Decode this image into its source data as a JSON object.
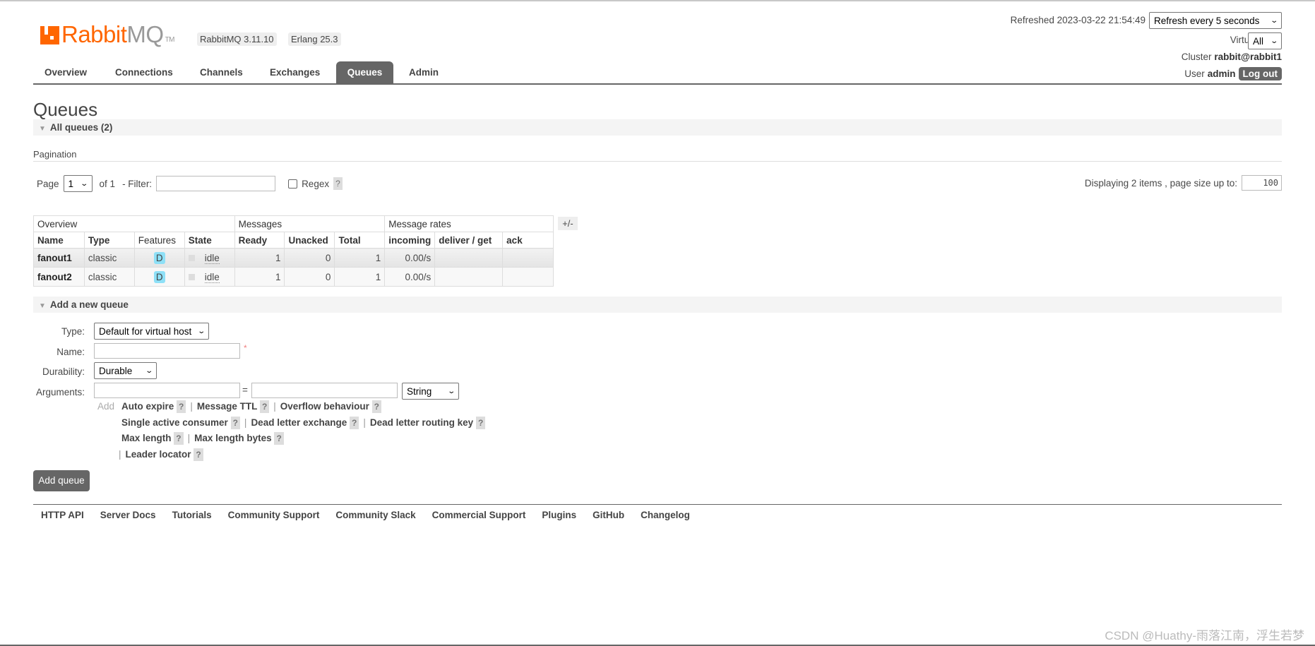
{
  "header": {
    "logo_text": "RabbitMQ",
    "logo_tm": "TM",
    "version_badge": "RabbitMQ 3.11.10",
    "erlang_badge": "Erlang 25.3",
    "refreshed": "Refreshed 2023-03-22 21:54:49",
    "refresh_select": "Refresh every 5 seconds",
    "vhost_label": "Virtual host",
    "vhost_select": "All",
    "cluster_label": "Cluster",
    "cluster_value": "rabbit@rabbit1",
    "user_label": "User",
    "user_value": "admin",
    "logout": "Log out"
  },
  "nav": {
    "tabs": [
      {
        "label": "Overview"
      },
      {
        "label": "Connections"
      },
      {
        "label": "Channels"
      },
      {
        "label": "Exchanges"
      },
      {
        "label": "Queues",
        "active": true
      },
      {
        "label": "Admin"
      }
    ]
  },
  "page_title": "Queues",
  "all_queues": "All queues (2)",
  "pagination": {
    "heading": "Pagination",
    "page_label": "Page",
    "page_value": "1",
    "of": "of 1",
    "filter_label": "- Filter:",
    "filter_value": "",
    "regex_label": "Regex",
    "help": "?",
    "displaying": "Displaying 2 items , page size up to:",
    "page_size": "100"
  },
  "table": {
    "groups": [
      "Overview",
      "Messages",
      "Message rates"
    ],
    "toggle": "+/-",
    "columns": [
      "Name",
      "Type",
      "Features",
      "State",
      "Ready",
      "Unacked",
      "Total",
      "incoming",
      "deliver / get",
      "ack"
    ],
    "rows": [
      {
        "name": "fanout1",
        "type": "classic",
        "features": "D",
        "state": "idle",
        "ready": "1",
        "unacked": "0",
        "total": "1",
        "incoming": "0.00/s",
        "deliver": "",
        "ack": ""
      },
      {
        "name": "fanout2",
        "type": "classic",
        "features": "D",
        "state": "idle",
        "ready": "1",
        "unacked": "0",
        "total": "1",
        "incoming": "0.00/s",
        "deliver": "",
        "ack": ""
      }
    ]
  },
  "add_queue": {
    "heading": "Add a new queue",
    "type_label": "Type:",
    "type_value": "Default for virtual host",
    "name_label": "Name:",
    "name_value": "",
    "required": "*",
    "durability_label": "Durability:",
    "durability_value": "Durable",
    "arguments_label": "Arguments:",
    "eq": "=",
    "arg_type": "String",
    "add": "Add",
    "arg_links": [
      "Auto expire",
      "Message TTL",
      "Overflow behaviour",
      "Single active consumer",
      "Dead letter exchange",
      "Dead letter routing key",
      "Max length",
      "Max length bytes",
      "Leader locator"
    ],
    "sep": "|",
    "help": "?",
    "submit": "Add queue"
  },
  "footer": {
    "links": [
      "HTTP API",
      "Server Docs",
      "Tutorials",
      "Community Support",
      "Community Slack",
      "Commercial Support",
      "Plugins",
      "GitHub",
      "Changelog"
    ]
  },
  "watermark": "CSDN @Huathy-雨落江南，浮生若梦",
  "colors": {
    "brand": "#ff6600",
    "tab_active": "#666666",
    "durable_tag": "#8ee0f7"
  }
}
